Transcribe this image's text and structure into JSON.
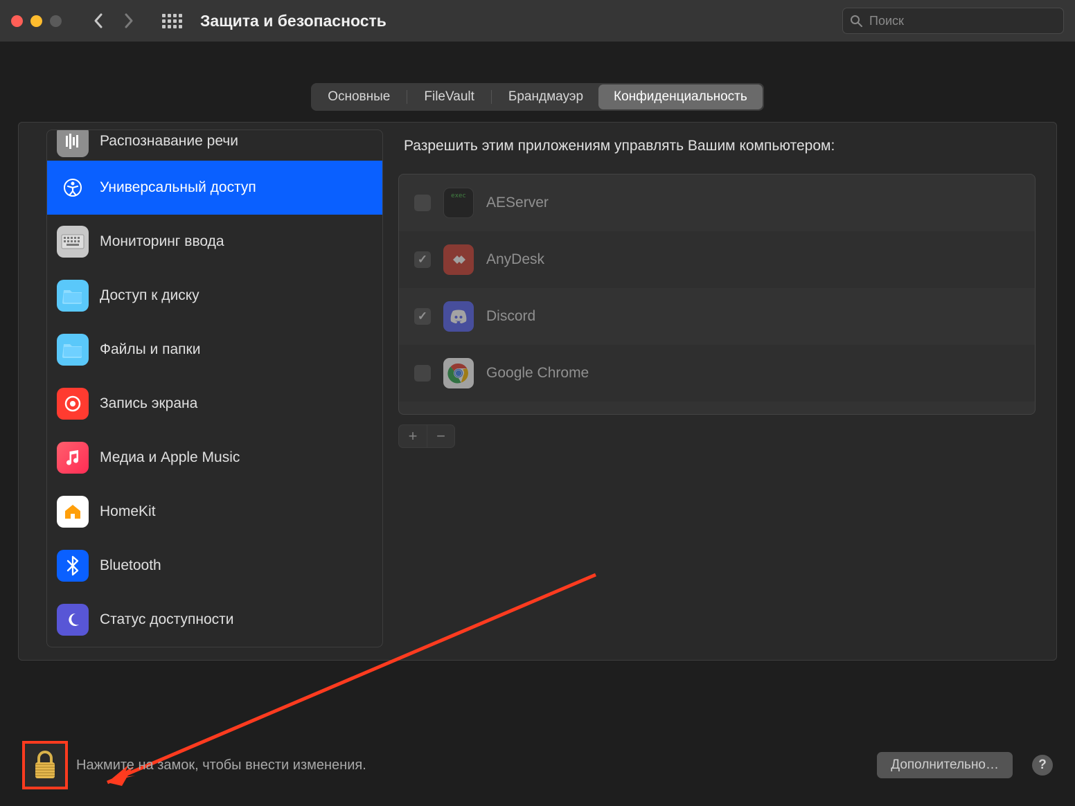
{
  "window": {
    "title": "Защита и безопасность",
    "search_placeholder": "Поиск"
  },
  "tabs": [
    {
      "label": "Основные",
      "selected": false
    },
    {
      "label": "FileVault",
      "selected": false
    },
    {
      "label": "Брандмауэр",
      "selected": false
    },
    {
      "label": "Конфиденциальность",
      "selected": true
    }
  ],
  "sidebar": {
    "items": [
      {
        "label": "Распознавание речи",
        "icon": "speech-icon",
        "color": "#8e8e8e"
      },
      {
        "label": "Универсальный доступ",
        "icon": "accessibility-icon",
        "color": "#0a60ff",
        "selected": true
      },
      {
        "label": "Мониторинг ввода",
        "icon": "keyboard-icon",
        "color": "#6b6b6b"
      },
      {
        "label": "Доступ к диску",
        "icon": "folder-icon",
        "color": "#5ac8fa"
      },
      {
        "label": "Файлы и папки",
        "icon": "folder-icon",
        "color": "#5ac8fa"
      },
      {
        "label": "Запись экрана",
        "icon": "record-icon",
        "color": "#ff3b30"
      },
      {
        "label": "Медиа и Apple Music",
        "icon": "music-icon",
        "color": "#ff2d55"
      },
      {
        "label": "HomeKit",
        "icon": "home-icon",
        "color": "#ffffff"
      },
      {
        "label": "Bluetooth",
        "icon": "bluetooth-icon",
        "color": "#0a60ff"
      },
      {
        "label": "Статус доступности",
        "icon": "moon-icon",
        "color": "#5856d6"
      }
    ]
  },
  "content": {
    "header": "Разрешить этим приложениям управлять Вашим компьютером:",
    "apps": [
      {
        "name": "AEServer",
        "checked": false,
        "icon": "terminal-icon",
        "color": "#1a1a1a"
      },
      {
        "name": "AnyDesk",
        "checked": true,
        "icon": "anydesk-icon",
        "color": "#d14338"
      },
      {
        "name": "Discord",
        "checked": true,
        "icon": "discord-icon",
        "color": "#5865f2"
      },
      {
        "name": "Google Chrome",
        "checked": false,
        "icon": "chrome-icon",
        "color": "#ffffff"
      }
    ],
    "add_label": "+",
    "remove_label": "−"
  },
  "footer": {
    "lock_text": "Нажмите на замок, чтобы внести изменения.",
    "advanced_label": "Дополнительно…",
    "help_label": "?"
  }
}
